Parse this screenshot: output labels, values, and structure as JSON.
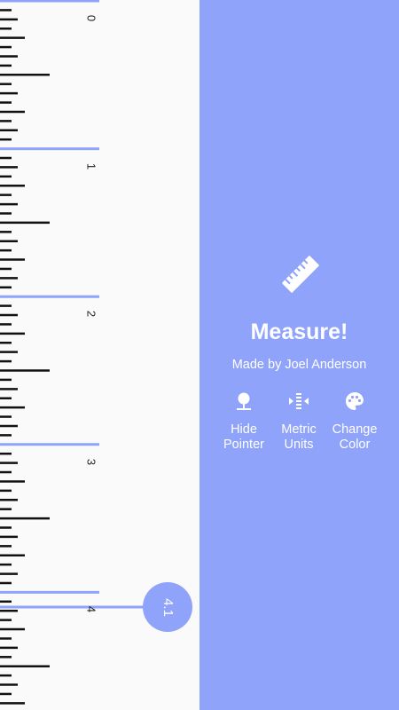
{
  "ruler": {
    "inch_labels": [
      "0",
      "1",
      "2",
      "3",
      "4"
    ],
    "pointer_value": "4.1"
  },
  "panel": {
    "title": "Measure!",
    "credit": "Made by Joel Anderson",
    "actions": [
      {
        "label": "Hide\nPointer",
        "icon": "pointer-pin-icon"
      },
      {
        "label": "Metric\nUnits",
        "icon": "metric-units-icon"
      },
      {
        "label": "Change\nColor",
        "icon": "palette-icon"
      }
    ]
  },
  "colors": {
    "accent": "#8fa3fb",
    "ruler_background": "#fafafa",
    "tick": "#111111",
    "text_on_accent": "#ffffff"
  }
}
